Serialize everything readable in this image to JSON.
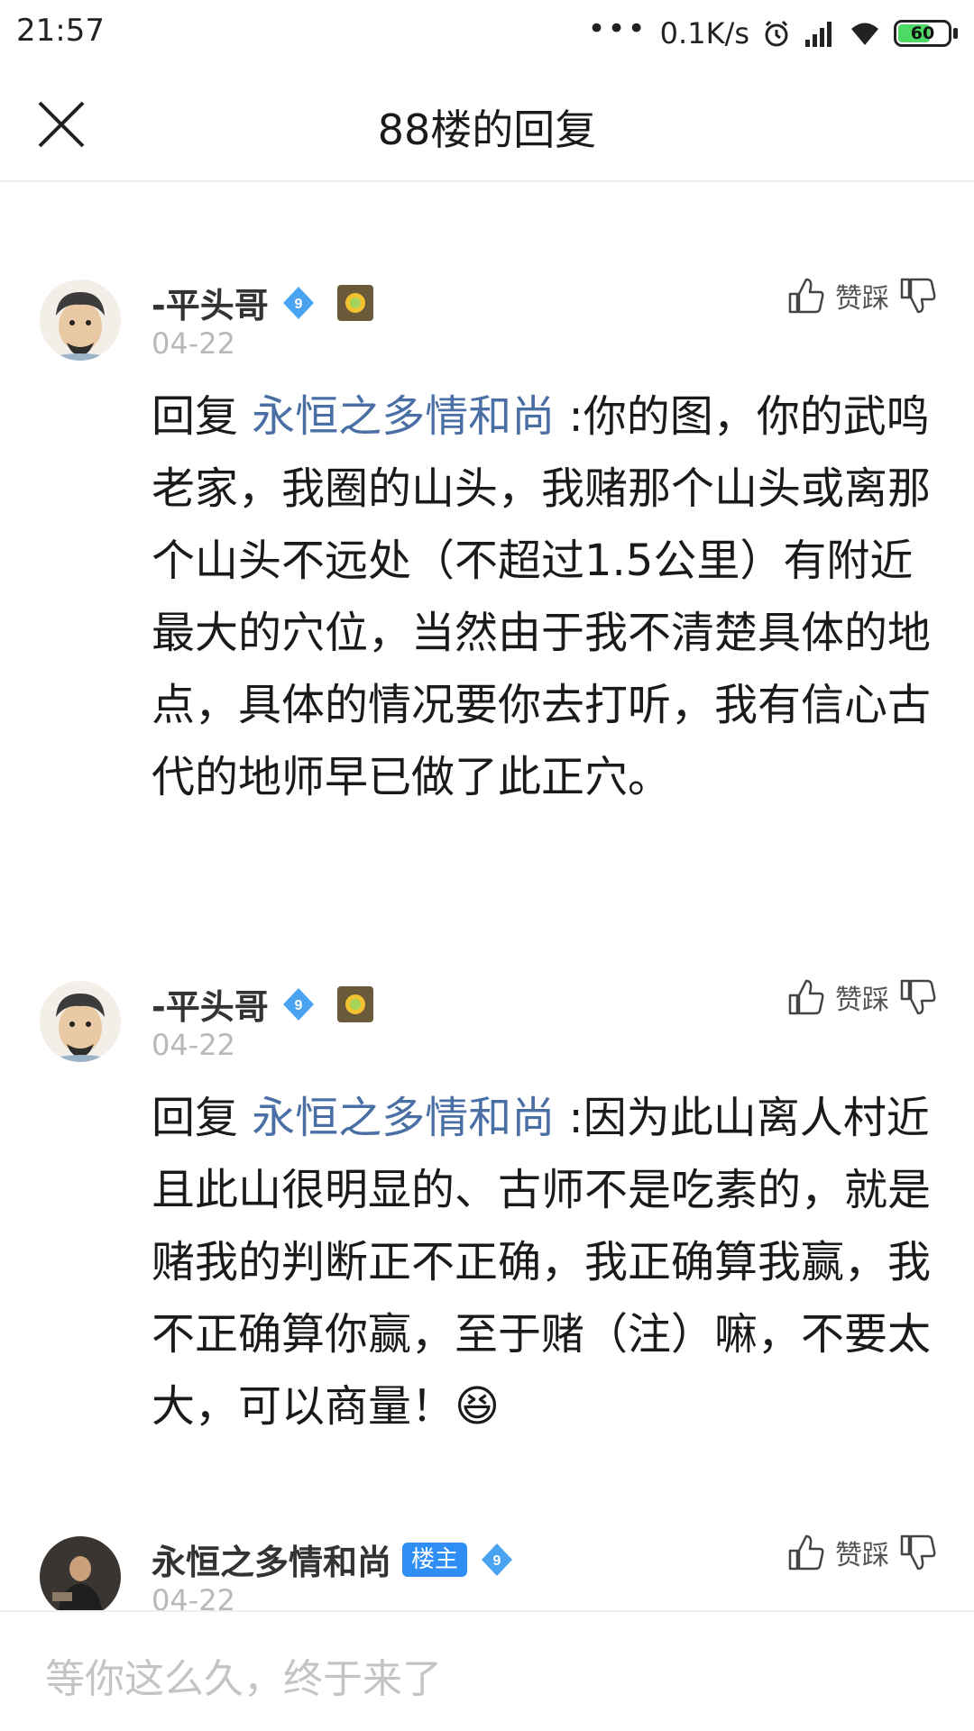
{
  "status": {
    "time": "21:57",
    "dots": "•••",
    "net_speed": "0.1K/s",
    "battery": "60",
    "battery_level": 0.6,
    "icons": [
      "alarm-icon",
      "signal-icon",
      "wifi-icon",
      "battery-icon"
    ]
  },
  "header": {
    "title": "88楼的回复"
  },
  "replies": [
    {
      "username": "-平头哥",
      "level": "9",
      "date": "04-22",
      "vote_label": "赞踩",
      "reply_prefix": "回复 ",
      "mention": "永恒之多情和尚",
      "text": " :你的图，你的武鸣老家，我圈的山头，我赌那个山头或离那个山头不远处（不超过1.5公里）有附近最大的穴位，当然由于我不清楚具体的地点，具体的情况要你去打听，我有信心古代的地师早已做了此正穴。"
    },
    {
      "username": "-平头哥",
      "level": "9",
      "date": "04-22",
      "vote_label": "赞踩",
      "reply_prefix": "回复 ",
      "mention": "永恒之多情和尚",
      "text": " :因为此山离人村近且此山很明显的、古师不是吃素的，就是赌我的判断正不正确，我正确算我赢，我不正确算你赢，至于赌（注）嘛，不要太大，可以商量！",
      "emoji": "😆"
    },
    {
      "username": "永恒之多情和尚",
      "owner_badge": "楼主",
      "level": "9",
      "date": "04-22",
      "vote_label": "赞踩"
    }
  ],
  "input": {
    "placeholder": "等你这么久，终于来了"
  },
  "colors": {
    "mention": "#4a6fa5",
    "level_badge": "#4aa3f0",
    "owner_badge": "#2f8ef3",
    "date": "#b8b8b8"
  }
}
